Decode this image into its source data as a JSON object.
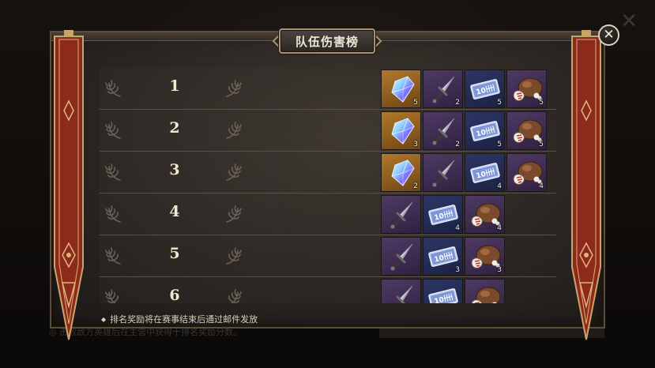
{
  "title": "队伍伤害榜",
  "note": "排名奖励将在赛事结束后通过邮件发放",
  "bottom_text": "◎ 击败敌方英雄后在主营中获得十排名奖励分数。",
  "icons": {
    "close": "close-icon",
    "laurel": "laurel-icon",
    "crystal": "crystal-icon",
    "dagger": "dagger-icon",
    "ticket": "ticket-icon",
    "sack": "sack-icon"
  },
  "rows": [
    {
      "rank": "1",
      "rewards": [
        {
          "icon": "crystal-icon",
          "qty": "5"
        },
        {
          "icon": "dagger-icon",
          "qty": "2"
        },
        {
          "icon": "ticket-icon",
          "qty": "5"
        },
        {
          "icon": "sack-icon",
          "qty": "5"
        }
      ]
    },
    {
      "rank": "2",
      "rewards": [
        {
          "icon": "crystal-icon",
          "qty": "3"
        },
        {
          "icon": "dagger-icon",
          "qty": "2"
        },
        {
          "icon": "ticket-icon",
          "qty": "5"
        },
        {
          "icon": "sack-icon",
          "qty": "5"
        }
      ]
    },
    {
      "rank": "3",
      "rewards": [
        {
          "icon": "crystal-icon",
          "qty": "2"
        },
        {
          "icon": "dagger-icon",
          "qty": ""
        },
        {
          "icon": "ticket-icon",
          "qty": "4"
        },
        {
          "icon": "sack-icon",
          "qty": "4"
        }
      ]
    },
    {
      "rank": "4",
      "rewards": [
        {
          "icon": "dagger-icon",
          "qty": ""
        },
        {
          "icon": "ticket-icon",
          "qty": "4"
        },
        {
          "icon": "sack-icon",
          "qty": "4"
        }
      ]
    },
    {
      "rank": "5",
      "rewards": [
        {
          "icon": "dagger-icon",
          "qty": ""
        },
        {
          "icon": "ticket-icon",
          "qty": "3"
        },
        {
          "icon": "sack-icon",
          "qty": "3"
        }
      ]
    },
    {
      "rank": "6",
      "rewards": [
        {
          "icon": "dagger-icon",
          "qty": ""
        },
        {
          "icon": "ticket-icon",
          "qty": ""
        },
        {
          "icon": "sack-icon",
          "qty": ""
        }
      ]
    }
  ],
  "colors": {
    "crystal_bg": "#a06c26",
    "dagger_bg": "#3f2d52",
    "ticket_bg": "#252c56",
    "banner_red": "#8e2a1c",
    "banner_gold": "#c9a46a"
  }
}
